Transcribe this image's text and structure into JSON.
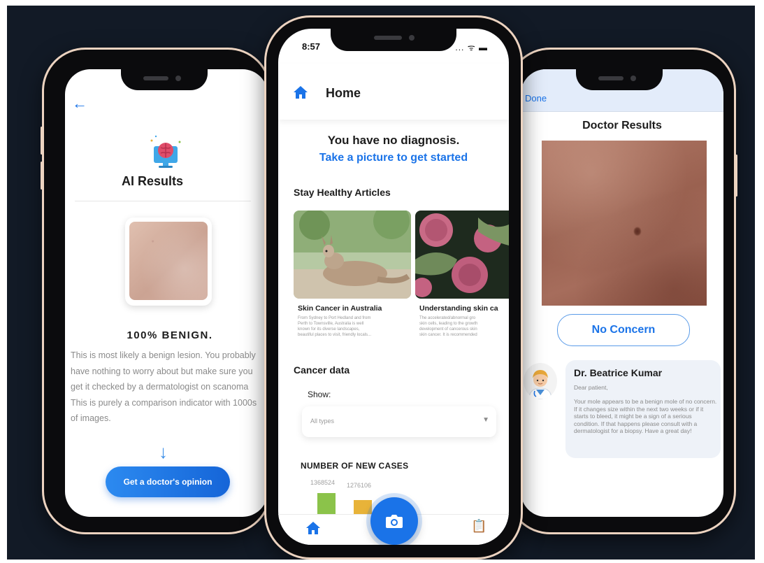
{
  "left_screen": {
    "title": "AI Results",
    "result": "100% BENIGN.",
    "description_lines": [
      "This is most likely a benign lesion. You probably",
      "have nothing to worry about but make sure you",
      "get it checked by a dermatologist on scanoma",
      "This is purely a comparison indicator with 1000s",
      "of images."
    ],
    "cta_label": "Get a doctor's opinion",
    "icons": {
      "back": "arrow-left-icon",
      "hero": "brain-monitor-icon",
      "down": "arrow-down-icon"
    }
  },
  "center_screen": {
    "status_time": "8:57",
    "status_icons": "... ᯤ ▬",
    "header_title": "Home",
    "no_diagnosis": "You have no diagnosis.",
    "take_picture": "Take a picture to get started",
    "articles_title": "Stay Healthy Articles",
    "articles": [
      {
        "title": "Skin Cancer in Australia",
        "excerpt_lines": [
          "From Sydney to Port Hedland and from",
          "Perth to Townsville, Australia is well",
          "known for its diverse landscapes,",
          "beautiful places to visit, friendly locals..."
        ]
      },
      {
        "title": "Understanding skin ca",
        "excerpt_lines": [
          "The accelerated/abnormal gro",
          "skin cells, leading to the growth",
          "development of cancerous skin",
          "skin cancer. It is recommended"
        ]
      }
    ],
    "cancer_data_title": "Cancer data",
    "show_label": "Show:",
    "select_value": "All types",
    "chart_title": "NUMBER OF NEW CASES",
    "chart_values": [
      "1368524",
      "1276106"
    ],
    "colors": {
      "accent": "#1a73e8",
      "bar1": "#8bc34a",
      "bar2": "#e8b339"
    },
    "icons": {
      "home": "home-icon",
      "camera": "camera-icon",
      "clipboard": "clipboard-icon"
    }
  },
  "right_screen": {
    "done_label": "Done",
    "title": "Doctor Results",
    "concern_label": "No Concern",
    "doctor_name": "Dr. Beatrice Kumar",
    "greeting": "Dear patient,",
    "message": "Your mole appears to be a benign mole of no concern. If it changes size within the next two weeks or if it starts to bleed, it might be a sign of a serious condition. If that happens please consult with a dermatologist for a biopsy.  Have a great day!"
  }
}
